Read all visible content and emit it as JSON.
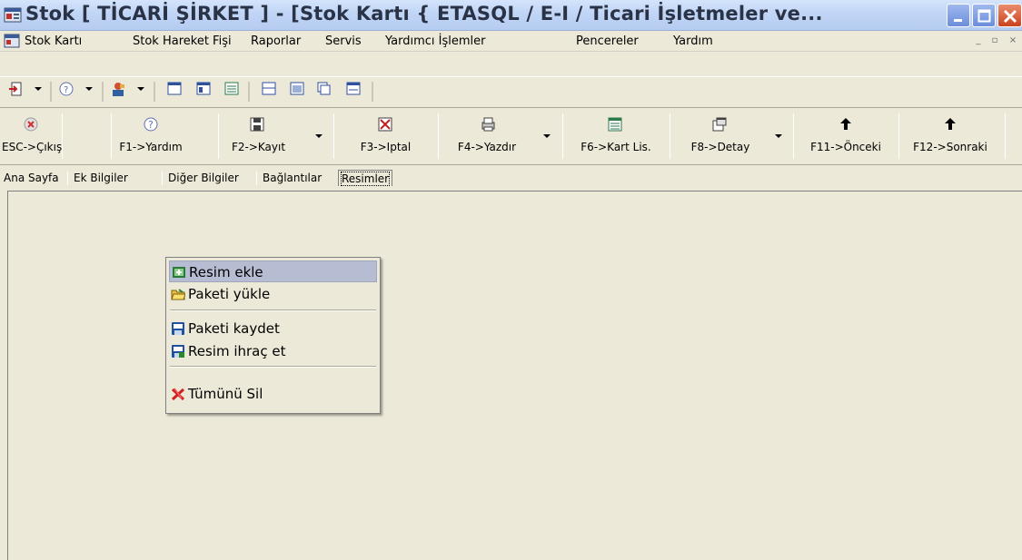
{
  "window": {
    "title": "Stok [ TİCARİ ŞİRKET ]  - [Stok Kartı { ETASQL / E-I / Ticari İşletmeler ve..."
  },
  "menu": {
    "items": [
      {
        "label": "Stok Kartı"
      },
      {
        "label": "Stok Hareket Fişi"
      },
      {
        "label": "Raporlar"
      },
      {
        "label": "Servis"
      },
      {
        "label": "Yardımcı İşlemler"
      },
      {
        "label": "Pencereler"
      },
      {
        "label": "Yardım"
      }
    ]
  },
  "function_bar": {
    "buttons": [
      {
        "label": "ESC->Çıkış",
        "icon": "exit-icon"
      },
      {
        "label": "F1->Yardım",
        "icon": "help-icon"
      },
      {
        "label": "F2->Kayıt",
        "icon": "save-icon"
      },
      {
        "label": "F3->Iptal",
        "icon": "cancel-icon"
      },
      {
        "label": "F4->Yazdır",
        "icon": "print-icon"
      },
      {
        "label": "F6->Kart Lis.",
        "icon": "list-icon"
      },
      {
        "label": "F8->Detay",
        "icon": "detail-icon"
      },
      {
        "label": "F11->Önceki",
        "icon": "arrow-left-icon"
      },
      {
        "label": "F12->Sonraki",
        "icon": "arrow-right-icon"
      }
    ]
  },
  "tabs": [
    {
      "label": "Ana Sayfa"
    },
    {
      "label": "Ek Bilgiler"
    },
    {
      "label": "Diğer Bilgiler"
    },
    {
      "label": "Bağlantılar"
    },
    {
      "label": "Resimler",
      "active": true
    }
  ],
  "context_menu": {
    "items": [
      {
        "label": "Resim ekle",
        "icon": "add-image-icon",
        "highlighted": true
      },
      {
        "label": "Paketi yükle",
        "icon": "open-folder-icon"
      },
      {
        "label": "Paketi kaydet",
        "icon": "floppy-save-icon"
      },
      {
        "label": "Resim ihraç et",
        "icon": "export-image-icon"
      },
      {
        "label": "Tümünü Sil",
        "icon": "delete-all-icon"
      }
    ]
  },
  "colors": {
    "titlebar": "#c2d6f6",
    "background": "#ece9d8",
    "menu_highlight": "#b6bdd2",
    "close_button": "#c9421d"
  }
}
